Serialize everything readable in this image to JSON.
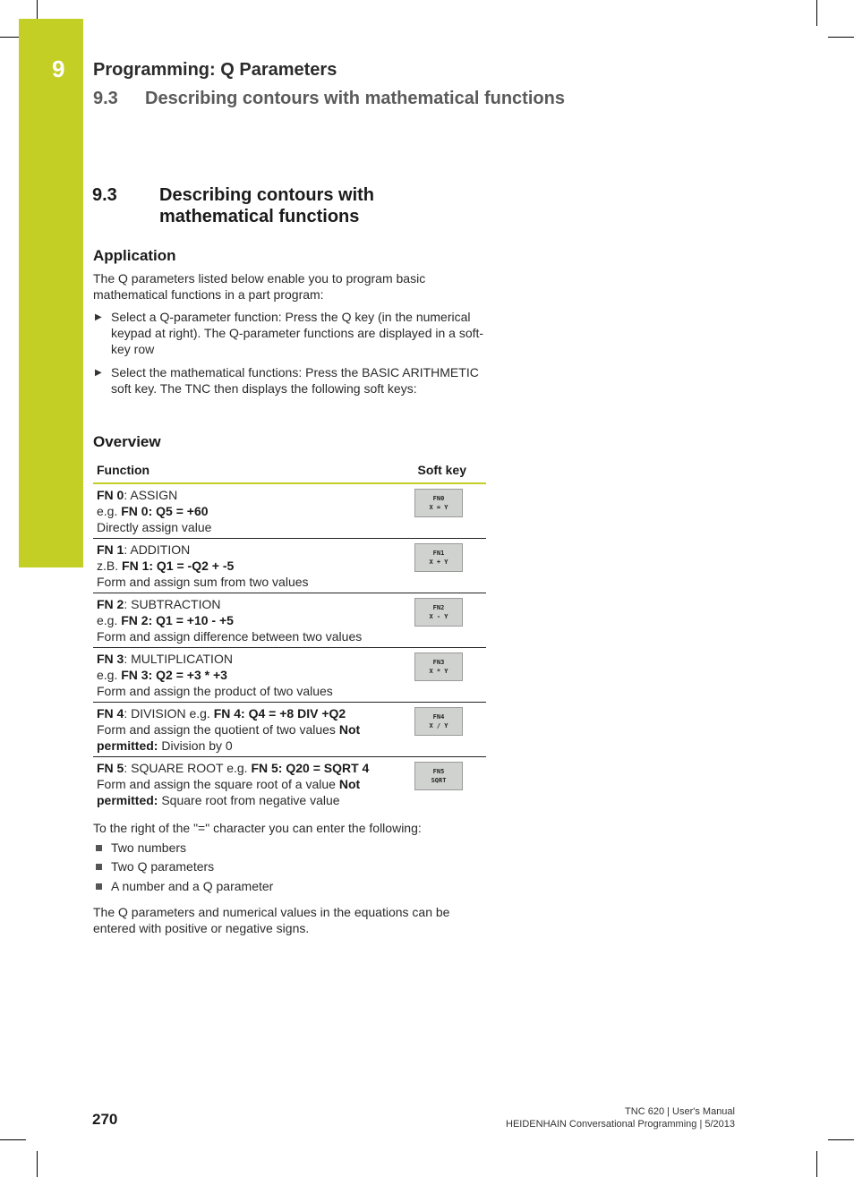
{
  "chapter": {
    "number": "9",
    "title": "Programming: Q Parameters",
    "section_number": "9.3",
    "section_title": "Describing contours with mathematical functions",
    "accent_color": "#c4cf25"
  },
  "section": {
    "number": "9.3",
    "title_line1": "Describing contours with",
    "title_line2": "mathematical functions"
  },
  "application": {
    "heading": "Application",
    "intro": "The Q parameters listed below enable you to program basic mathematical functions in a part program:",
    "steps": [
      "Select a Q-parameter function: Press the Q key (in the numerical keypad at right). The Q-parameter functions are displayed in a soft-key row",
      "Select the mathematical functions: Press the BASIC ARITHMETIC soft key. The TNC then displays the following soft keys:"
    ]
  },
  "overview": {
    "heading": "Overview",
    "columns": [
      "Function",
      "Soft key"
    ],
    "rows": [
      {
        "fn": "FN 0",
        "name": ": ASSIGN",
        "eg_prefix": "e.g. ",
        "example": "FN 0: Q5 = +60",
        "desc": "Directly assign value",
        "not_label": "",
        "not_text": "",
        "key_line1": "FN0",
        "key_line2": "X = Y"
      },
      {
        "fn": "FN 1",
        "name": ": ADDITION",
        "eg_prefix": "z.B. ",
        "example": "FN 1: Q1 = -Q2 + -5",
        "desc": "Form and assign sum from two values",
        "not_label": "",
        "not_text": "",
        "key_line1": "FN1",
        "key_line2": "X + Y"
      },
      {
        "fn": "FN 2",
        "name": ": SUBTRACTION",
        "eg_prefix": "e.g. ",
        "example": "FN 2: Q1 = +10 - +5",
        "desc": "Form and assign difference between two values",
        "not_label": "",
        "not_text": "",
        "key_line1": "FN2",
        "key_line2": "X - Y"
      },
      {
        "fn": "FN 3",
        "name": ": MULTIPLICATION",
        "eg_prefix": "e.g. ",
        "example": "FN 3: Q2 = +3 * +3",
        "desc": "Form and assign the product of two values",
        "not_label": "",
        "not_text": "",
        "key_line1": "FN3",
        "key_line2": "X * Y"
      },
      {
        "fn": "FN 4",
        "name": ": DIVISION e.g. ",
        "eg_prefix": "",
        "example": "FN 4: Q4 = +8 DIV +Q2",
        "desc": "Form and assign the quotient of two values ",
        "not_label": "Not permitted:",
        "not_text": " Division by 0",
        "key_line1": "FN4",
        "key_line2": "X / Y"
      },
      {
        "fn": "FN 5",
        "name": ": SQUARE ROOT e.g. ",
        "eg_prefix": "",
        "example": "FN 5: Q20 = SQRT 4",
        "desc": "Form and assign the square root of a value ",
        "not_label": "Not permitted:",
        "not_text": " Square root from negative value",
        "key_line1": "FN5",
        "key_line2": "SQRT"
      }
    ]
  },
  "right_of_equals": {
    "intro": "To the right of the \"=\" character you can enter the following:",
    "items": [
      "Two numbers",
      "Two Q parameters",
      "A number and a Q parameter"
    ]
  },
  "closing": "The Q parameters and numerical values in the equations can be entered with positive or negative signs.",
  "footer": {
    "page_number": "270",
    "line1": "TNC 620 | User's Manual",
    "line2": "HEIDENHAIN Conversational Programming | 5/2013"
  }
}
